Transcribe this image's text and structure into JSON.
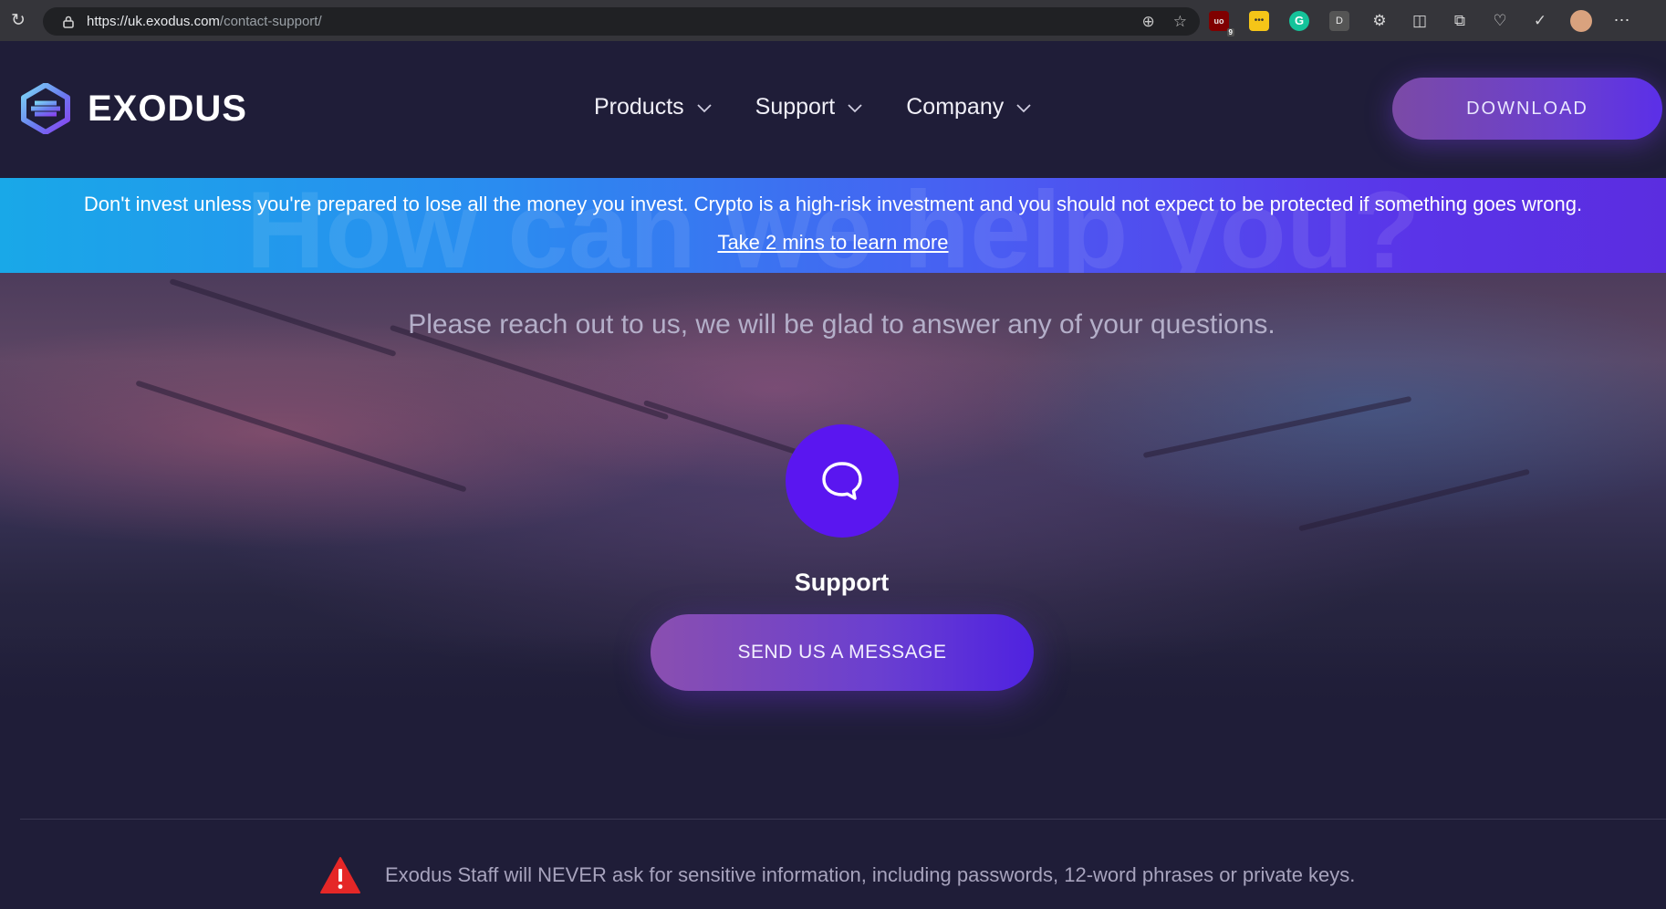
{
  "browser": {
    "url_host": "https://uk.exodus.com",
    "url_path": "/contact-support/",
    "ublock_count": "9",
    "ext_d_label": "D"
  },
  "header": {
    "brand": "EXODUS",
    "nav": [
      {
        "label": "Products"
      },
      {
        "label": "Support"
      },
      {
        "label": "Company"
      }
    ],
    "download_label": "DOWNLOAD"
  },
  "banner": {
    "ghost_title": "How can we help you?",
    "risk_text": "Don't invest unless you're prepared to lose all the money you invest. Crypto is a high-risk investment and you should not expect to be protected if something goes wrong.",
    "link_text": "Take 2 mins to learn more"
  },
  "main": {
    "subtitle": "Please reach out to us, we will be glad to answer any of your questions.",
    "support_label": "Support",
    "message_button": "SEND US A MESSAGE",
    "warning": "Exodus Staff will NEVER ask for sensitive information, including passwords, 12-word phrases or private keys."
  },
  "colors": {
    "accent": "#5a16f0",
    "header_bg": "#1f1d38",
    "warning_red": "#e52727"
  }
}
